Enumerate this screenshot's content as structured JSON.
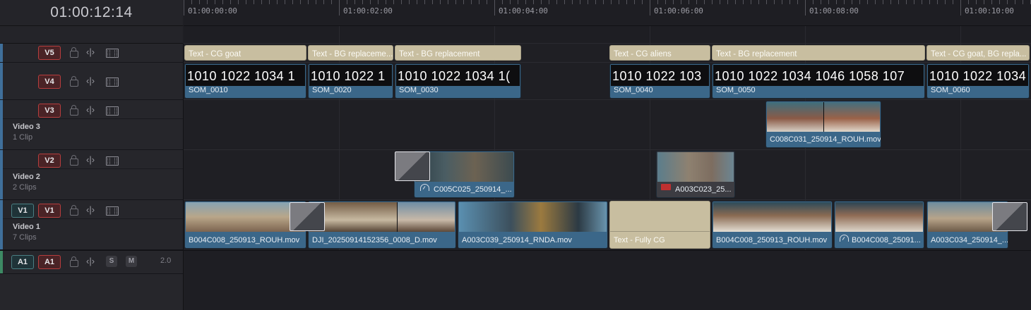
{
  "timecode": "01:00:12:14",
  "ruler_labels": [
    "01:00:00:00",
    "01:00:02:00",
    "01:00:04:00",
    "01:00:06:00",
    "01:00:08:00",
    "01:00:10:00"
  ],
  "tracks": {
    "v5": {
      "dest": "",
      "src": "V5"
    },
    "v4": {
      "src": "V4"
    },
    "v3": {
      "src": "V3",
      "name": "Video 3",
      "count": "1 Clip"
    },
    "v2": {
      "src": "V2",
      "name": "Video 2",
      "count": "2 Clips"
    },
    "v1": {
      "dest": "V1",
      "src": "V1",
      "name": "Video 1",
      "count": "7 Clips"
    },
    "a1": {
      "dest": "A1",
      "src": "A1",
      "solo": "S",
      "mute": "M",
      "channels": "2.0"
    }
  },
  "clips": {
    "v5": [
      "Text - CG goat",
      "Text - BG replaceme...",
      "Text - BG replacement",
      "Text - CG aliens",
      "Text - BG replacement",
      "Text - CG goat, BG repla..."
    ],
    "v4": [
      {
        "name": "SOM_0010",
        "nums": "1010    1022    1034    1"
      },
      {
        "name": "SOM_0020",
        "nums": "1010    1022    1"
      },
      {
        "name": "SOM_0030",
        "nums": "1010    1022    1034    1("
      },
      {
        "name": "SOM_0040",
        "nums": "1010    1022    103"
      },
      {
        "name": "SOM_0050",
        "nums": "1010    1022    1034    1046    1058    107"
      },
      {
        "name": "SOM_0060",
        "nums": "1010    1022    1034"
      }
    ],
    "v3": [
      "C008C031_250914_ROUH.mov"
    ],
    "v2": [
      "C005C025_250914_...",
      "A003C023_25..."
    ],
    "v1": [
      "B004C008_250913_ROUH.mov",
      "DJI_20250914152356_0008_D.mov",
      "A003C039_250914_RNDA.mov",
      "Text - Fully CG",
      "B004C008_250913_ROUH.mov",
      "B004C008_25091...",
      "A003C034_250914_..."
    ]
  },
  "colors": {
    "text_clip": "#c8bea0",
    "video_clip": "#3b6789",
    "record_red": "#b73d3d",
    "dest_teal": "#4a7f83",
    "track_stripe": "#3f6f9a"
  },
  "icons": [
    "lock-icon",
    "trim-icon",
    "film-icon",
    "speed-icon",
    "flag-icon"
  ]
}
